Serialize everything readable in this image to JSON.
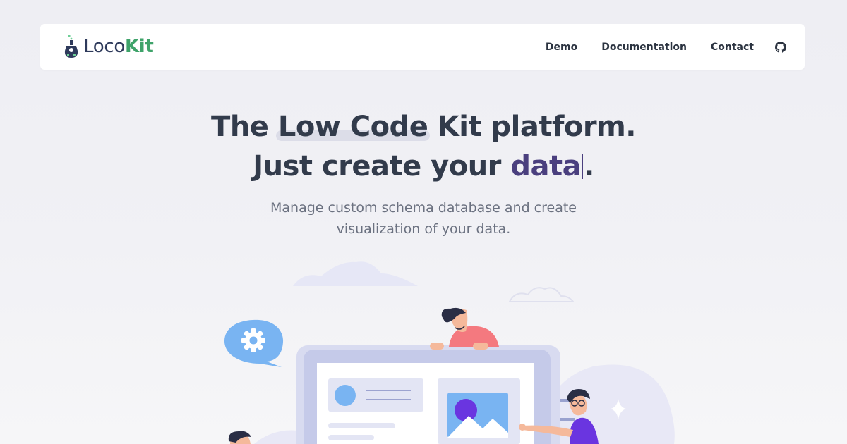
{
  "brand": {
    "name_part1": "Loco",
    "name_part2": "Kit",
    "accent_color": "#3fa36a",
    "text_color": "#2e3a5b"
  },
  "nav": {
    "links": [
      "Demo",
      "Documentation",
      "Contact"
    ],
    "github_icon": "github-icon"
  },
  "hero": {
    "line1_before": "The ",
    "line1_highlight": "Low Code",
    "line1_after": " Kit platform.",
    "line2_before": "Just create your ",
    "line2_typed": "data",
    "line2_after": ".",
    "subtitle": "Manage custom schema database and create visualization of your data.",
    "typed_color": "#4a3f7e"
  },
  "illustration": {
    "icons": [
      "gear-icon",
      "image-icon",
      "sparkle-icon"
    ]
  }
}
